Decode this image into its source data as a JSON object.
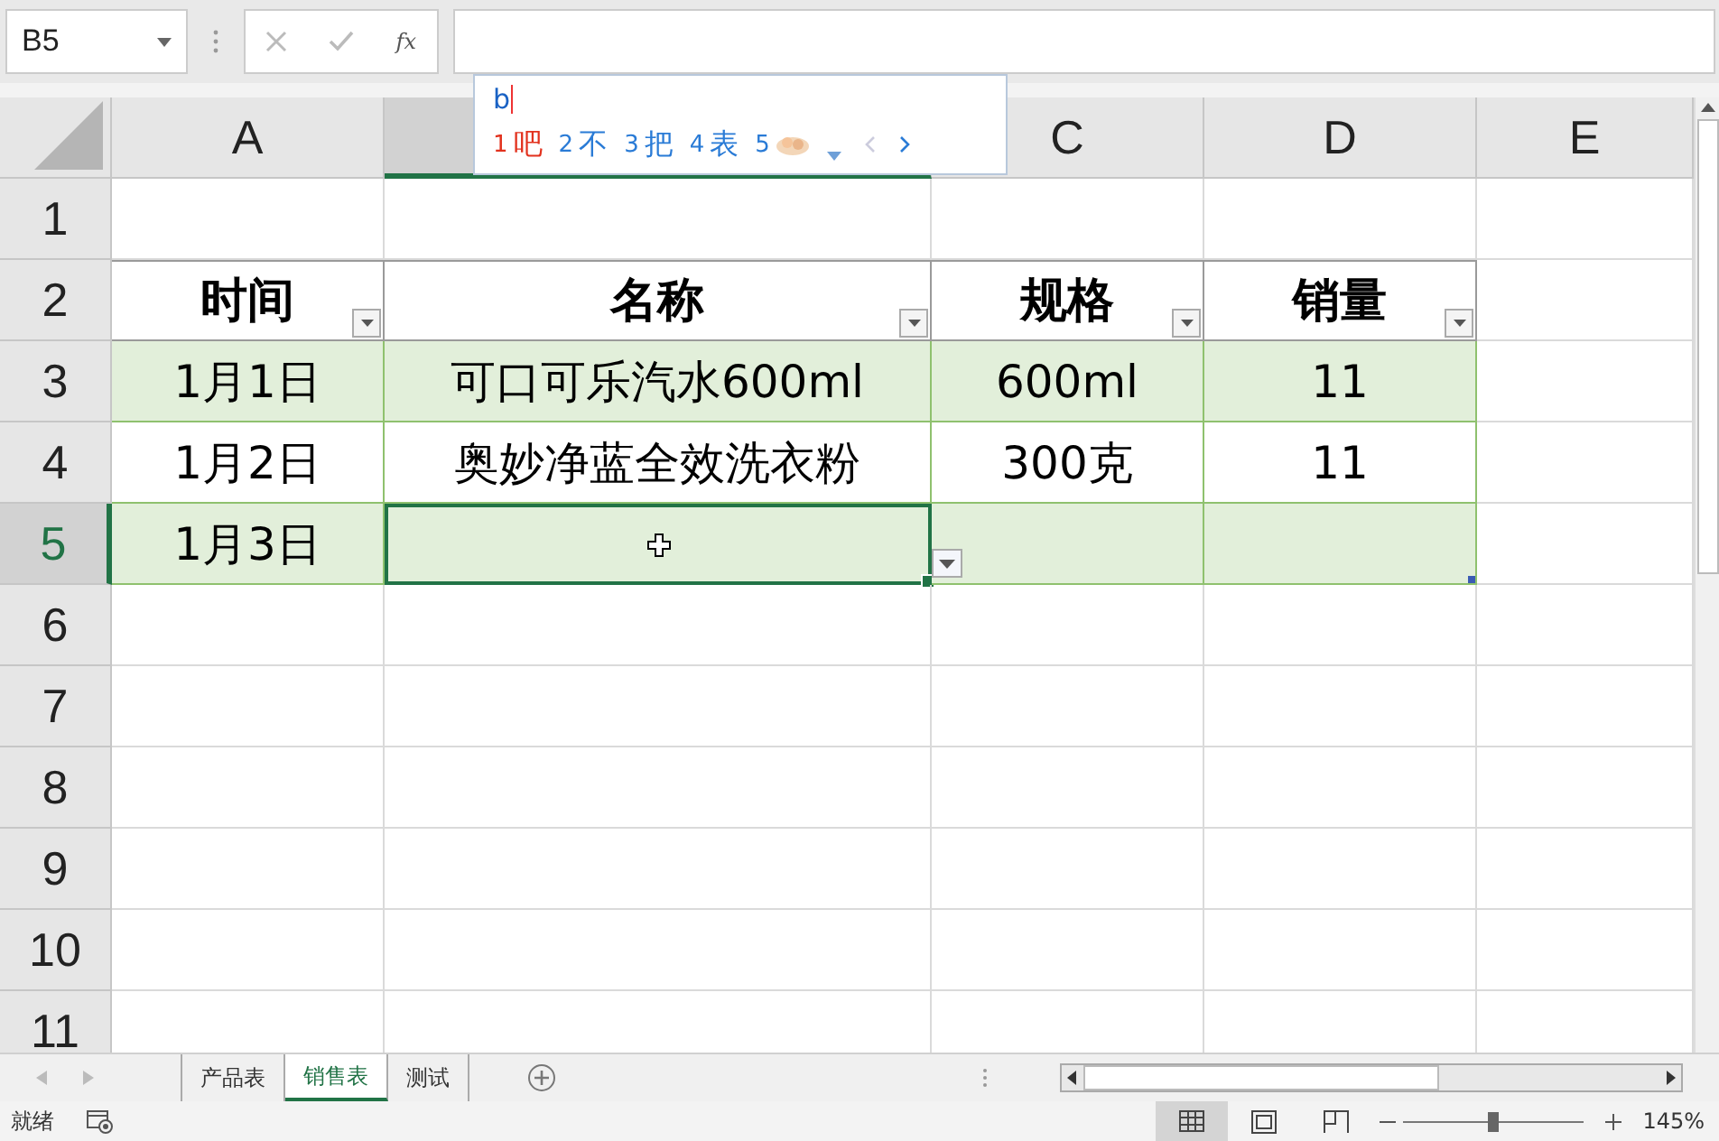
{
  "name_box": {
    "value": "B5"
  },
  "formula_bar": {
    "function_label": "fx"
  },
  "ime": {
    "input": "b",
    "candidates": [
      {
        "index": "1",
        "kind": "text",
        "text": "吧",
        "selected": true
      },
      {
        "index": "2",
        "kind": "text",
        "text": "不",
        "selected": false
      },
      {
        "index": "3",
        "kind": "text",
        "text": "把",
        "selected": false
      },
      {
        "index": "4",
        "kind": "text",
        "text": "表",
        "selected": false
      },
      {
        "index": "5",
        "kind": "image",
        "selected": false
      }
    ]
  },
  "columns": [
    {
      "label": "A",
      "selected": false
    },
    {
      "selected": true
    },
    {
      "label": "C",
      "selected": false
    },
    {
      "label": "D",
      "selected": false
    },
    {
      "label": "E",
      "selected": false
    }
  ],
  "row_numbers": [
    {
      "label": "1",
      "selected": false
    },
    {
      "label": "2",
      "selected": false
    },
    {
      "label": "3",
      "selected": false
    },
    {
      "label": "4",
      "selected": false
    },
    {
      "label": "5",
      "selected": true
    },
    {
      "label": "6",
      "selected": false
    },
    {
      "label": "7",
      "selected": false
    },
    {
      "label": "8",
      "selected": false
    },
    {
      "label": "9",
      "selected": false
    },
    {
      "label": "10",
      "selected": false
    },
    {
      "label": "11",
      "selected": false
    }
  ],
  "table": {
    "headers": [
      "时间",
      "名称",
      "规格",
      "销量"
    ],
    "rows": [
      {
        "banded": true,
        "cells": [
          {
            "text": "1月1日",
            "selected": false
          },
          {
            "text": "可口可乐汽水600ml",
            "selected": false
          },
          {
            "text": "600ml",
            "selected": false
          },
          {
            "text": "11",
            "selected": false
          }
        ]
      },
      {
        "banded": false,
        "cells": [
          {
            "text": "1月2日",
            "selected": false
          },
          {
            "text": "奥妙净蓝全效洗衣粉",
            "selected": false
          },
          {
            "text": "300克",
            "selected": false
          },
          {
            "text": "11",
            "selected": false
          }
        ]
      },
      {
        "banded": true,
        "cells": [
          {
            "text": "1月3日",
            "selected": false
          },
          {
            "selected": true
          },
          {
            "selected": false
          },
          {
            "selected": false
          }
        ]
      }
    ]
  },
  "sheet_tabs": [
    {
      "label": "产品表",
      "selected": false
    },
    {
      "label": "销售表",
      "selected": true
    },
    {
      "label": "测试",
      "selected": false
    }
  ],
  "status_bar": {
    "status": "就绪",
    "views": [
      {
        "kind": "normal",
        "selected": true
      },
      {
        "kind": "page_layout",
        "selected": false
      },
      {
        "kind": "page_break",
        "selected": false
      }
    ],
    "zoom": {
      "level": 0.5,
      "reading": "145%"
    }
  }
}
